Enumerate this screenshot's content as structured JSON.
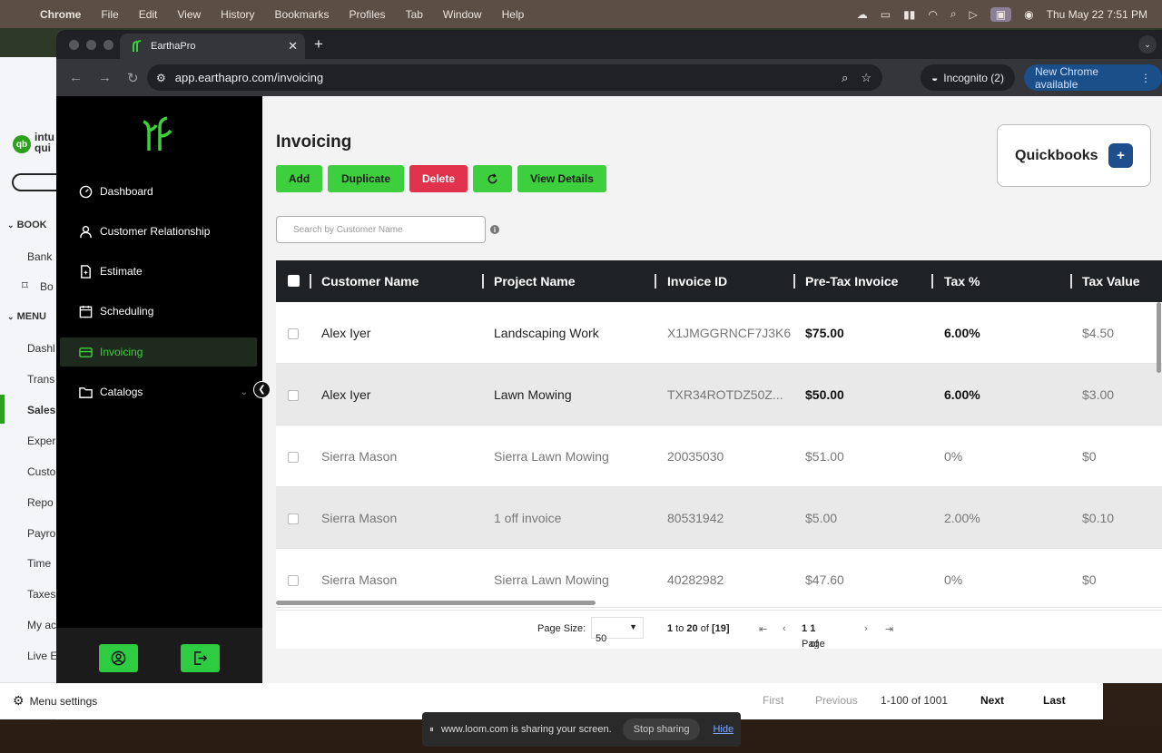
{
  "menubar": {
    "app_name": "Chrome",
    "items": [
      "File",
      "Edit",
      "View",
      "History",
      "Bookmarks",
      "Profiles",
      "Tab",
      "Window",
      "Help"
    ],
    "datetime": "Thu May 22  7:51 PM"
  },
  "qb_background": {
    "logo_text": "intu qui",
    "sections": [
      "BOOK",
      "MENU"
    ],
    "items": [
      "Bank",
      "Bo",
      "Dashl",
      "Trans",
      "Sales",
      "Exper",
      "Custo",
      "Repo",
      "Payro",
      "Time",
      "Taxes",
      "My ac",
      "Live E"
    ],
    "menu_settings": "Menu settings",
    "pager": {
      "first": "First",
      "previous": "Previous",
      "range": "1-100 of 1001",
      "next": "Next",
      "last": "Last"
    }
  },
  "browser": {
    "tab_title": "EarthaPro",
    "url": "app.earthapro.com/invoicing",
    "incognito": "Incognito (2)",
    "update": "New Chrome available"
  },
  "sidebar": {
    "items": [
      {
        "label": "Dashboard",
        "icon": "gauge-icon"
      },
      {
        "label": "Customer Relationship",
        "icon": "user-icon"
      },
      {
        "label": "Estimate",
        "icon": "document-icon"
      },
      {
        "label": "Scheduling",
        "icon": "calendar-icon"
      },
      {
        "label": "Invoicing",
        "icon": "card-icon"
      },
      {
        "label": "Catalogs",
        "icon": "folder-icon"
      }
    ],
    "active": "Invoicing"
  },
  "page": {
    "title": "Invoicing",
    "buttons": {
      "add": "Add",
      "duplicate": "Duplicate",
      "delete": "Delete",
      "view_details": "View Details"
    },
    "quickbooks_label": "Quickbooks",
    "search_placeholder": "Search by Customer Name"
  },
  "table": {
    "columns": [
      "Customer Name",
      "Project Name",
      "Invoice ID",
      "Pre-Tax Invoice",
      "Tax %",
      "Tax Value"
    ],
    "rows": [
      {
        "customer": "Alex Iyer",
        "project": "Landscaping Work",
        "invoice_id": "X1JMGGRNCF7J3K6",
        "pretax": "$75.00",
        "tax_pct": "6.00%",
        "tax_value": "$4.50"
      },
      {
        "customer": "Alex Iyer",
        "project": "Lawn Mowing",
        "invoice_id": "TXR34ROTDZ50Z...",
        "pretax": "$50.00",
        "tax_pct": "6.00%",
        "tax_value": "$3.00"
      },
      {
        "customer": "Sierra Mason",
        "project": "Sierra Lawn Mowing",
        "invoice_id": "20035030",
        "pretax": "$51.00",
        "tax_pct": "0%",
        "tax_value": "$0"
      },
      {
        "customer": "Sierra Mason",
        "project": "1 off invoice",
        "invoice_id": "80531942",
        "pretax": "$5.00",
        "tax_pct": "2.00%",
        "tax_value": "$0.10"
      },
      {
        "customer": "Sierra Mason",
        "project": "Sierra Lawn Mowing",
        "invoice_id": "40282982",
        "pretax": "$47.60",
        "tax_pct": "0%",
        "tax_value": "$0"
      }
    ],
    "footer": {
      "page_size_label": "Page Size:",
      "page_size": "50",
      "range_from": "1",
      "range_to": "20",
      "range_total": "[19]",
      "page_label": "Page",
      "page_current": "1",
      "page_of": "of",
      "page_total": "1"
    }
  },
  "loom": {
    "message": "www.loom.com is sharing your screen.",
    "stop": "Stop sharing",
    "hide": "Hide"
  },
  "colors": {
    "accent_green": "#3ecf3e",
    "delete_red": "#e0334b",
    "quickbooks_blue": "#1f4e8c",
    "sidebar_bg": "#000000"
  }
}
